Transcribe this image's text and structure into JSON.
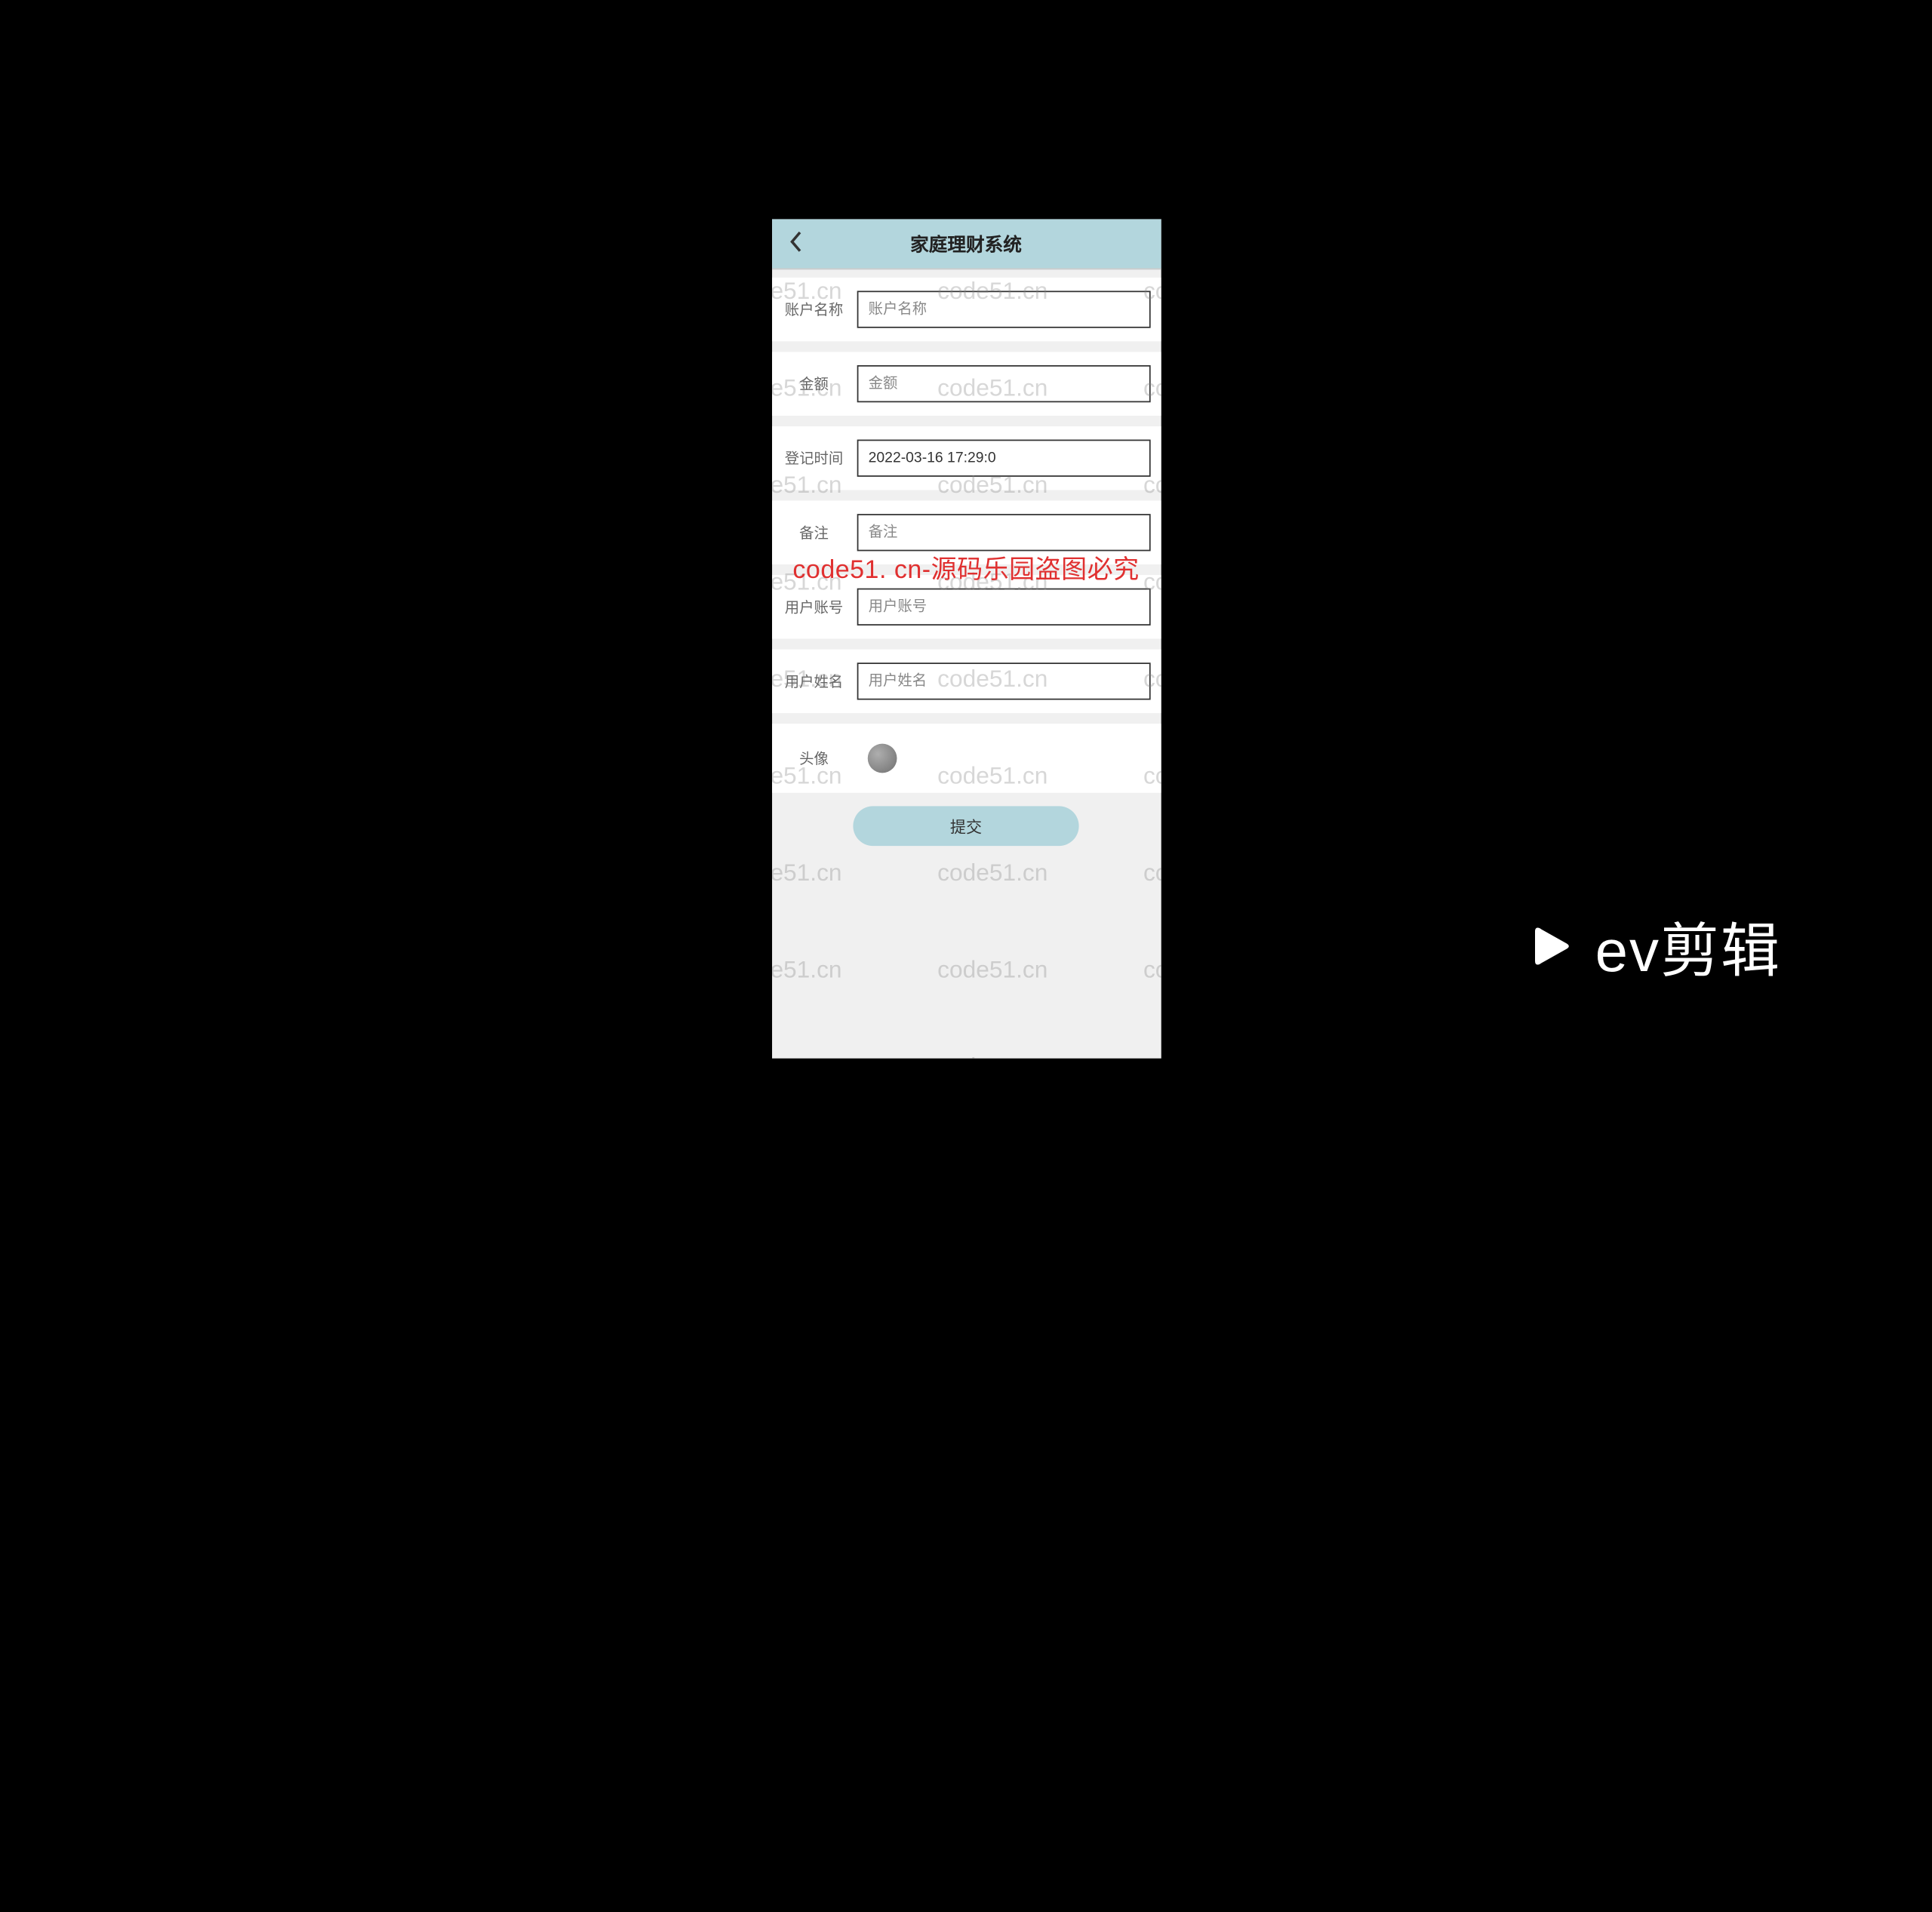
{
  "header": {
    "title": "家庭理财系统"
  },
  "form": {
    "account_name": {
      "label": "账户名称",
      "placeholder": "账户名称",
      "value": ""
    },
    "amount": {
      "label": "金额",
      "placeholder": "金额",
      "value": ""
    },
    "register_time": {
      "label": "登记时间",
      "placeholder": "",
      "value": "2022-03-16 17:29:0"
    },
    "remark": {
      "label": "备注",
      "placeholder": "备注",
      "value": ""
    },
    "user_account": {
      "label": "用户账号",
      "placeholder": "用户账号",
      "value": ""
    },
    "user_name": {
      "label": "用户姓名",
      "placeholder": "用户姓名",
      "value": ""
    },
    "avatar": {
      "label": "头像"
    }
  },
  "submit_label": "提交",
  "watermark_text": "code51.cn",
  "red_banner": "code51. cn-源码乐园盗图必究",
  "ev_brand": "ev剪辑"
}
